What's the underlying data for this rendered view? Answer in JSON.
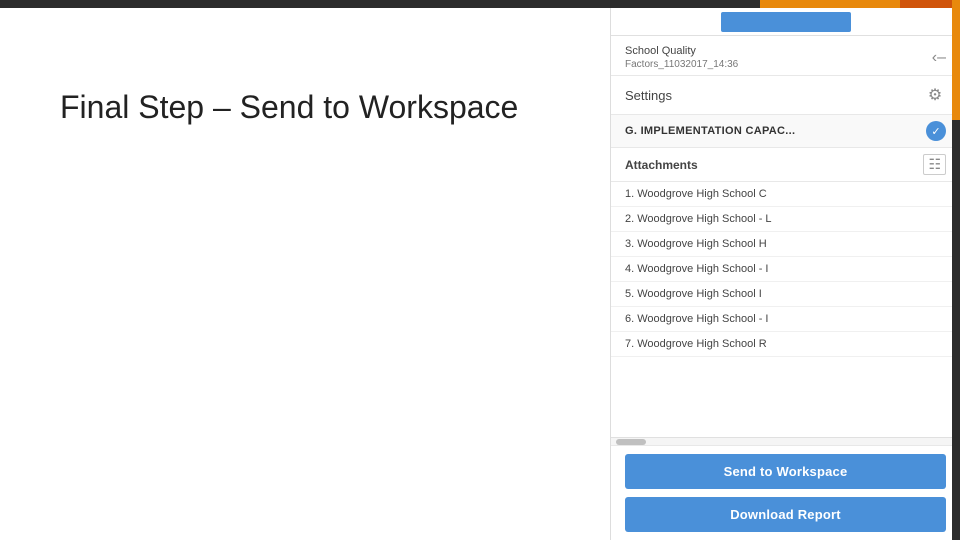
{
  "topBar": {
    "backgroundColor": "#2c2c2c",
    "accentColor": "#e8890c"
  },
  "leftArea": {
    "title": "Final Step – Send to Workspace"
  },
  "rightPanel": {
    "fileName": {
      "line1": "School Quality",
      "line2": "Factors_11032017_14:36"
    },
    "settingsLabel": "Settings",
    "sectionHeader": "G. IMPLEMENTATION CAPAC...",
    "attachmentsLabel": "Attachments",
    "attachmentItems": [
      "1. Woodgrove High School  C",
      "2. Woodgrove High School - L",
      "3. Woodgrove High School  H",
      "4. Woodgrove High School - I",
      "5. Woodgrove High School  I",
      "6. Woodgrove High School - I",
      "7. Woodgrove High School  R"
    ],
    "buttons": {
      "sendLabel": "Send to Workspace",
      "downloadLabel": "Download Report"
    }
  }
}
